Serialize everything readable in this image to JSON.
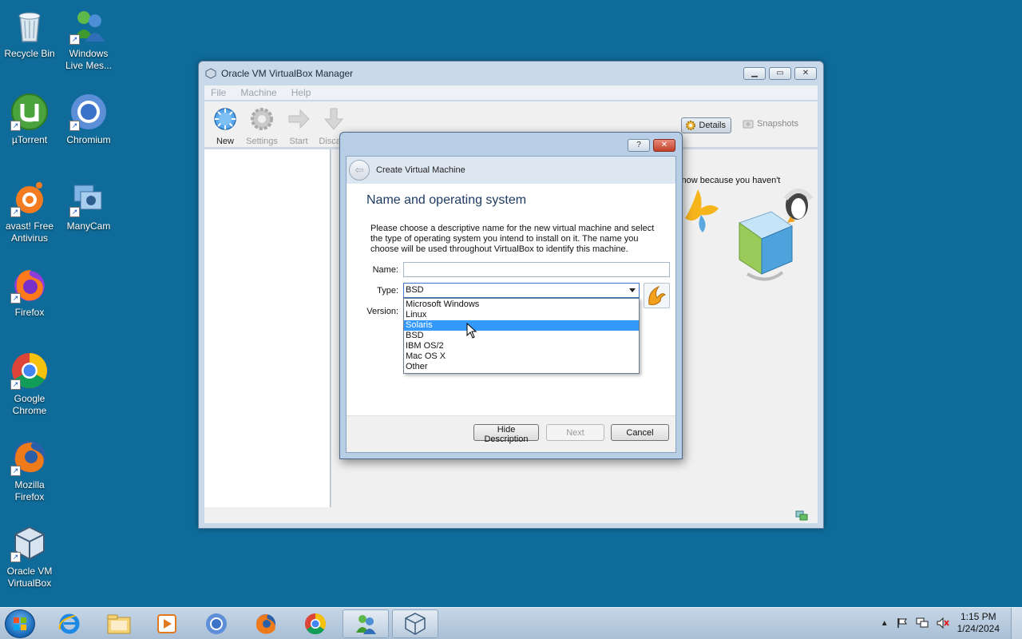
{
  "desktop": {
    "icons": [
      {
        "label": "Recycle Bin",
        "icon": "recycle-bin-icon"
      },
      {
        "label": "Windows Live Mes...",
        "icon": "windows-live-messenger-icon"
      },
      {
        "label": "µTorrent",
        "icon": "utorrent-icon"
      },
      {
        "label": "Chromium",
        "icon": "chromium-icon"
      },
      {
        "label": "avast! Free Antivirus",
        "icon": "avast-icon"
      },
      {
        "label": "ManyCam",
        "icon": "manycam-icon"
      },
      {
        "label": "Firefox",
        "icon": "firefox-icon"
      },
      {
        "label": "Google Chrome",
        "icon": "chrome-icon"
      },
      {
        "label": "Mozilla Firefox",
        "icon": "firefox-icon"
      },
      {
        "label": "Oracle VM VirtualBox",
        "icon": "virtualbox-icon"
      }
    ]
  },
  "vbox": {
    "title": "Oracle VM VirtualBox Manager",
    "menu": [
      "File",
      "Machine",
      "Help"
    ],
    "toolbar": {
      "new": "New",
      "settings": "Settings",
      "start": "Start",
      "discard": "Discard"
    },
    "details": "Details",
    "snapshots": "Snapshots",
    "welcome_fragment": "y now because you haven't"
  },
  "dialog": {
    "header": "Create Virtual Machine",
    "title": "Name and operating system",
    "description": "Please choose a descriptive name for the new virtual machine and select the type of operating system you intend to install on it. The name you choose will be used throughout VirtualBox to identify this machine.",
    "name_label": "Name:",
    "name_value": "",
    "type_label": "Type:",
    "type_value": "BSD",
    "version_label": "Version:",
    "type_options": [
      "Microsoft Windows",
      "Linux",
      "Solaris",
      "BSD",
      "IBM OS/2",
      "Mac OS X",
      "Other"
    ],
    "highlighted_option": "Solaris",
    "buttons": {
      "hide": "Hide Description",
      "next": "Next",
      "cancel": "Cancel"
    },
    "help": "?",
    "close": "✕"
  },
  "taskbar": {
    "apps": [
      "internet-explorer-icon",
      "file-explorer-icon",
      "media-player-icon",
      "chromium-icon",
      "firefox-icon",
      "chrome-icon",
      "windows-live-messenger-icon",
      "virtualbox-icon"
    ],
    "time": "1:15 PM",
    "date": "1/24/2024"
  },
  "colors": {
    "desktop": "#0f6c9a",
    "selection": "#3399ff",
    "title_blue": "#1e3c63"
  }
}
